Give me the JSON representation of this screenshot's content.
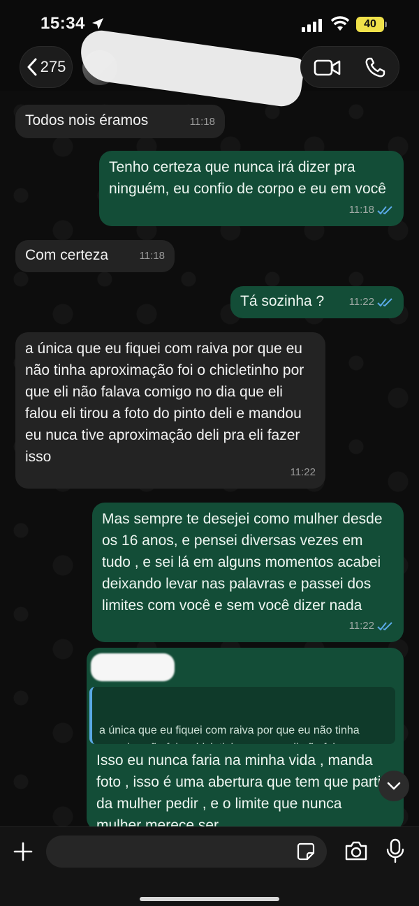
{
  "status": {
    "time": "15:34",
    "battery": "40"
  },
  "header": {
    "back_count": "275"
  },
  "messages": [
    {
      "dir": "in",
      "text": "Todos  nois éramos",
      "time": "11:18"
    },
    {
      "dir": "out",
      "text": "Tenho certeza que nunca irá dizer pra ninguém, eu confio de corpo e eu em você",
      "time": "11:18"
    },
    {
      "dir": "in",
      "text": "Com certeza",
      "time": "11:18"
    },
    {
      "dir": "out",
      "text": "Tá sozinha ?",
      "time": "11:22"
    },
    {
      "dir": "in",
      "text": "a única  que eu fiquei  com raiva por que  eu não  tinha  aproximação  foi o chicletinho por que eli não  falava comigo no dia que eli falou eli tirou a foto do pinto  deli e mandou  eu nuca tive aproximação  deli pra eli fazer  isso",
      "time": "11:22"
    },
    {
      "dir": "out",
      "text": "Mas sempre te desejei como mulher desde os 16 anos, e pensei diversas vezes em tudo  , e sei lá em alguns momentos acabei deixando levar nas palavras e passei dos limites com você e sem você dizer nada",
      "time": "11:22"
    },
    {
      "dir": "out",
      "quote": "a única  que eu fiquei  com raiva por que  eu não tinha  aproximação  foi o chicletinho por que eli não  falava comigo no dia que eli falou eli tirou...",
      "text": "Isso eu nunca faria na minha vida , manda foto , isso é uma abertura que tem que parti da mulher pedir , e o limite que nunca mulher merece ser"
    }
  ],
  "composer": {
    "placeholder": ""
  },
  "icons": [
    "back-chevron-icon",
    "location-arrow-icon",
    "signal-icon",
    "wifi-icon",
    "battery-icon",
    "video-call-icon",
    "phone-call-icon",
    "read-ticks-icon",
    "chevron-down-icon",
    "plus-icon",
    "sticker-icon",
    "camera-icon",
    "microphone-icon"
  ],
  "colors": {
    "incoming_bubble": "#232323",
    "outgoing_bubble": "#134d37",
    "read_ticks": "#5aa9e6",
    "battery": "#f0e14a"
  }
}
